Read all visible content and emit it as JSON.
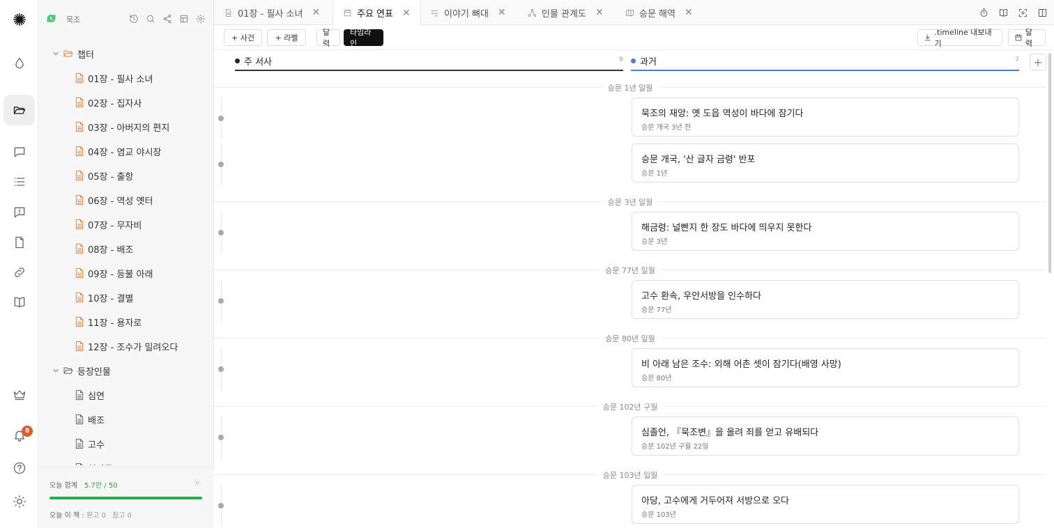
{
  "sidebar": {
    "workspace": "묵조",
    "folders": [
      {
        "name": "챕터",
        "items": [
          "01장 - 필사 소녀",
          "02장 - 집자사",
          "03장 - 아버지의 편지",
          "04장 - 염교 야시장",
          "05장 - 출항",
          "06장 - 역성 옛터",
          "07장 - 무자비",
          "08장 - 배조",
          "09장 - 등불 아래",
          "10장 - 결별",
          "11장 - 용자로",
          "12장 - 조수가 밀려오다"
        ]
      },
      {
        "name": "등장인물",
        "items": [
          "심연",
          "배조",
          "고수",
          "임안주"
        ]
      }
    ],
    "goal_label": "오늘 합계",
    "goal_value": "5.7만 / 50",
    "goal_progress": 1.0,
    "today_label": "오늘 이 책 :",
    "today_draft": "원고 0",
    "today_ref": "참고 0"
  },
  "activity": {
    "notification_count": "8"
  },
  "tabs": [
    {
      "label": "01장 - 필사 소녀",
      "icon": "document-icon"
    },
    {
      "label": "주요 연표",
      "icon": "calendar-icon",
      "active": true
    },
    {
      "label": "이야기 뼈대",
      "icon": "checklist-icon"
    },
    {
      "label": "인물 관계도",
      "icon": "network-icon"
    },
    {
      "label": "승문 해역",
      "icon": "map-icon"
    }
  ],
  "toolbar": {
    "add_event": "+ 사건",
    "add_label": "+ 라벨",
    "view_calendar": "달력",
    "view_timeline": "타임라인",
    "export": ".timeline 내보내기",
    "calendar": "달력"
  },
  "lanes": [
    {
      "name": "주 서사",
      "count": "9",
      "color": "#222222"
    },
    {
      "name": "과거",
      "count": "7",
      "color": "#4a7fd4"
    }
  ],
  "groups": [
    {
      "period": "승문 1년 일월",
      "events": [
        {
          "title": "묵조의 재앙: 옛 도읍 역성이 바다에 잠기다",
          "date": "승문 개국 3년 전"
        },
        {
          "title": "승문 개국, '산 글자 금령' 반포",
          "date": "승문 1년"
        }
      ]
    },
    {
      "period": "승문 3년 일월",
      "events": [
        {
          "title": "해금령: 널빤지 한 장도 바다에 띄우지 못한다",
          "date": "승문 3년"
        }
      ]
    },
    {
      "period": "승문 77년 일월",
      "events": [
        {
          "title": "고수 환속, 우안서방을 인수하다",
          "date": "승문 77년"
        }
      ]
    },
    {
      "period": "승문 80년 일월",
      "events": [
        {
          "title": "비 아래 남은 조수: 외해 어촌 셋이 잠기다(배영 사망)",
          "date": "승문 80년"
        }
      ]
    },
    {
      "period": "승문 102년 구월",
      "events": [
        {
          "title": "심졸언, 『묵조변』을 올려 죄를 얻고 유배되다",
          "date": "승문 102년 구월 22일"
        }
      ]
    },
    {
      "period": "승문 103년 일월",
      "events": [
        {
          "title": "아당, 고수에게 거두어져 서방으로 오다",
          "date": "승문 103년"
        }
      ]
    }
  ]
}
